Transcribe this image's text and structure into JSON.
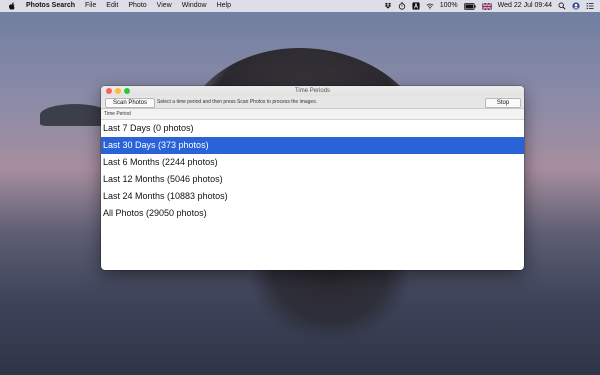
{
  "menubar": {
    "app_name": "Photos Search",
    "menus": [
      "File",
      "Edit",
      "Photo",
      "View",
      "Window",
      "Help"
    ],
    "battery": "100%",
    "datetime": "Wed 22 Jul  09:44"
  },
  "window": {
    "title": "Time Periods",
    "scan_button": "Scan Photos",
    "stop_button": "Stop",
    "hint": "Select a time period and then press Scan Photos to process the images.",
    "column_header": "Time Period",
    "periods": [
      {
        "label": "Last 7 Days (0 photos)",
        "selected": false
      },
      {
        "label": "Last 30 Days (373 photos)",
        "selected": true
      },
      {
        "label": "Last 6 Months (2244 photos)",
        "selected": false
      },
      {
        "label": "Last 12 Months (5046 photos)",
        "selected": false
      },
      {
        "label": "Last 24 Months (10883 photos)",
        "selected": false
      },
      {
        "label": "All Photos (29050 photos)",
        "selected": false
      }
    ]
  },
  "colors": {
    "selection": "#2a62d8",
    "close": "#fe5f57",
    "minimize": "#febc2e",
    "zoom": "#28c840"
  }
}
